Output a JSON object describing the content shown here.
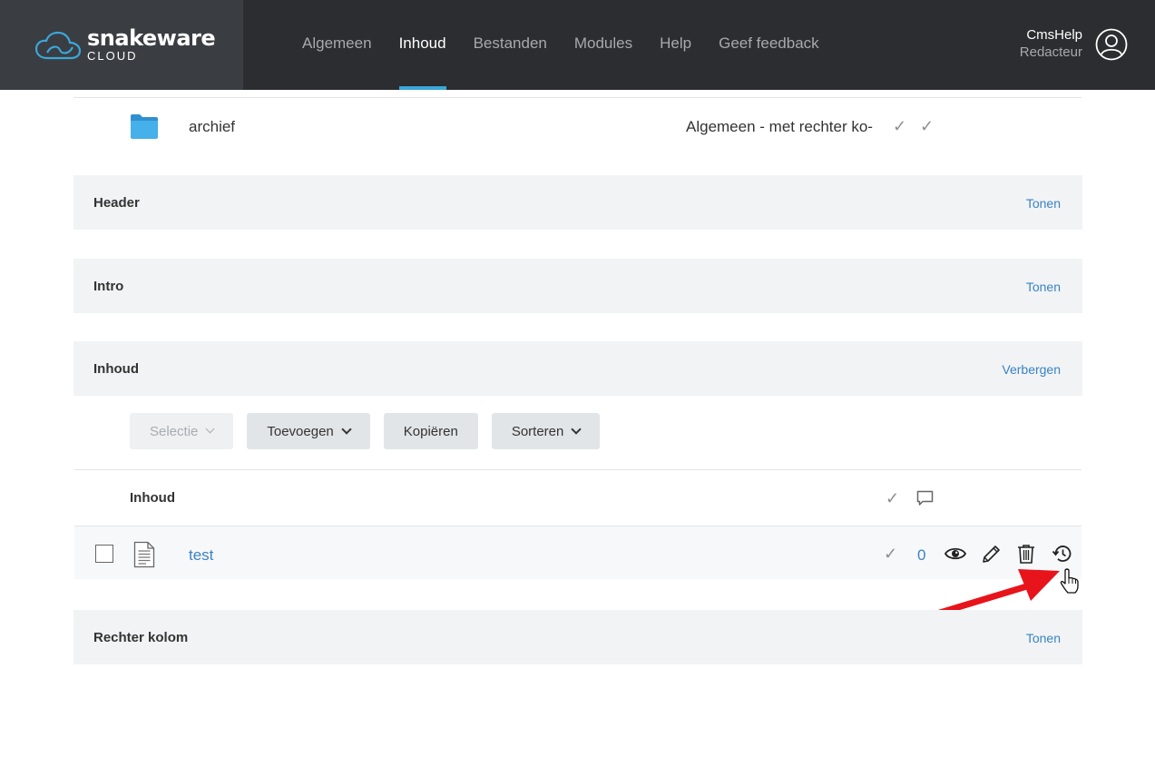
{
  "brand": {
    "name": "snakeware",
    "sub": "CLOUD"
  },
  "nav": [
    {
      "label": "Algemeen"
    },
    {
      "label": "Inhoud"
    },
    {
      "label": "Bestanden"
    },
    {
      "label": "Modules"
    },
    {
      "label": "Help"
    },
    {
      "label": "Geef feedback"
    }
  ],
  "user": {
    "name": "CmsHelp",
    "role": "Redacteur"
  },
  "folder_row": {
    "name": "archief",
    "template": "Algemeen - met rechter ko-",
    "check": "✓"
  },
  "sections": {
    "header": {
      "title": "Header",
      "link": "Tonen"
    },
    "intro": {
      "title": "Intro",
      "link": "Tonen"
    },
    "inhoud": {
      "title": "Inhoud",
      "link": "Verbergen"
    },
    "rechter_kolom": {
      "title": "Rechter kolom",
      "link": "Tonen"
    }
  },
  "toolbar": {
    "selectie": "Selectie",
    "toevoegen": "Toevoegen",
    "kopieren": "Kopiëren",
    "sorteren": "Sorteren"
  },
  "table": {
    "column_title": "Inhoud",
    "check": "✓",
    "rows": [
      {
        "name": "test",
        "comments": "0",
        "check": "✓"
      }
    ]
  },
  "colors": {
    "accent": "#3ba7d9",
    "link": "#3a83c4",
    "topbar": "#2b2d30",
    "arrow": "#e8141b"
  }
}
